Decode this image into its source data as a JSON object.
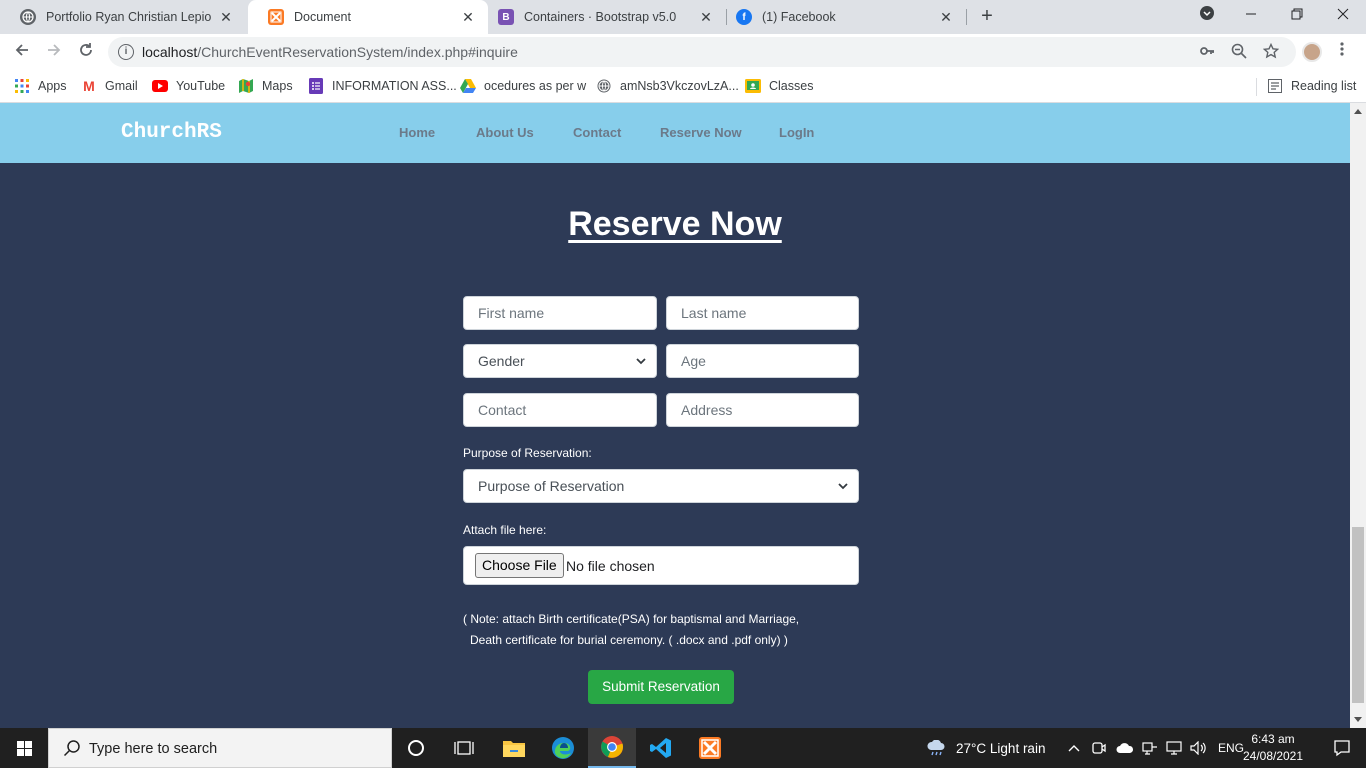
{
  "browser": {
    "tabs": [
      {
        "title": "Portfolio Ryan Christian Lepio",
        "icon": "globe-icon"
      },
      {
        "title": "Document",
        "icon": "xampp-icon",
        "active": true
      },
      {
        "title": "Containers · Bootstrap v5.0",
        "icon": "bootstrap-icon",
        "icon_text": "B"
      },
      {
        "title": "(1) Facebook",
        "icon": "facebook-icon",
        "icon_text": "f"
      }
    ],
    "close_glyph": "✕",
    "new_tab_glyph": "+",
    "url_host": "localhost",
    "url_path": "/ChurchEventReservationSystem/index.php#inquire"
  },
  "bookmarks": {
    "items": [
      {
        "label": "Apps",
        "icon": "apps-grid-icon"
      },
      {
        "label": "Gmail",
        "icon": "gmail-icon",
        "icon_text": "M"
      },
      {
        "label": "YouTube",
        "icon": "youtube-icon"
      },
      {
        "label": "Maps",
        "icon": "maps-icon"
      },
      {
        "label": "INFORMATION ASS...",
        "icon": "forms-icon"
      },
      {
        "label": "ocedures as per w",
        "icon": "drive-icon"
      },
      {
        "label": "amNsb3VkczovLzA...",
        "icon": "globe-icon"
      },
      {
        "label": "Classes",
        "icon": "classroom-icon"
      }
    ],
    "reading_list": "Reading list"
  },
  "site": {
    "brand": "ChurchRS",
    "nav": [
      "Home",
      "About Us",
      "Contact",
      "Reserve Now",
      "LogIn"
    ]
  },
  "form": {
    "heading": "Reserve Now",
    "first_name_placeholder": "First name",
    "last_name_placeholder": "Last name",
    "gender_selected": "Gender",
    "age_placeholder": "Age",
    "contact_placeholder": "Contact",
    "address_placeholder": "Address",
    "purpose_label": "Purpose of Reservation:",
    "purpose_selected": "Purpose of Reservation",
    "attach_label": "Attach file here:",
    "choose_file_label": "Choose File",
    "file_status": "No file chosen",
    "note_line1": "( Note: attach Birth certificate(PSA) for baptismal and Marriage,",
    "note_line2": "Death certificate for burial ceremony. ( .docx and .pdf only) )",
    "submit_label": "Submit Reservation"
  },
  "taskbar": {
    "search_placeholder": "Type here to search",
    "weather": "27°C  Light rain",
    "language": "ENG",
    "time": "6:43 am",
    "date": "24/08/2021"
  },
  "colors": {
    "navbar": "#87ceeb",
    "page_bg": "#2d3a56",
    "submit": "#28a745"
  }
}
